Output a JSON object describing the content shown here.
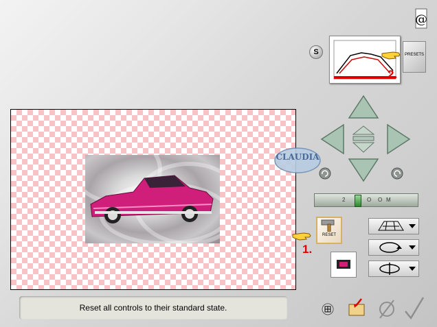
{
  "status_text": "Reset all controls to their standard state.",
  "presets_label": "PRESETS",
  "reset_label": "RESET",
  "zoom": {
    "ticks": [
      "2",
      "O",
      "O",
      "M"
    ]
  },
  "watermark": {
    "line1": "CLAUDIA"
  },
  "steps": {
    "one": "1.",
    "two": "2."
  },
  "s_label": "S",
  "colors": {
    "checker": "#f7c3c7",
    "car": "#d01f7a",
    "accent_red": "#e00000",
    "zoom_green": "#2c8a2c"
  },
  "icons": [
    "logo-icon",
    "hand-pointer-icon",
    "arrow-up-icon",
    "arrow-down-icon",
    "arrow-left-icon",
    "arrow-right-icon",
    "eject-icon",
    "rotate-left-icon",
    "rotate-right-icon",
    "hammer-icon",
    "grid-icon",
    "import-icon",
    "cancel-icon",
    "ok-check-icon"
  ]
}
